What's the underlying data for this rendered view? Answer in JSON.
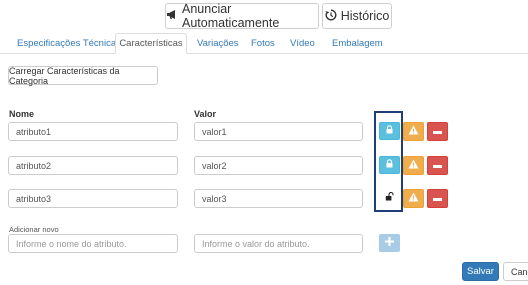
{
  "header": {
    "announce_label": "Anunciar Automaticamente",
    "history_label": "Histórico"
  },
  "tabs": [
    {
      "label": "Especificações Técnicas"
    },
    {
      "label": "Características"
    },
    {
      "label": "Variações"
    },
    {
      "label": "Fotos"
    },
    {
      "label": "Vídeo"
    },
    {
      "label": "Embalagem"
    }
  ],
  "load_button_label": "Carregar Características da Categoria",
  "columns": {
    "name": "Nome",
    "value": "Valor"
  },
  "rows": [
    {
      "name": "atributo1",
      "value": "valor1",
      "lock": "locked"
    },
    {
      "name": "atributo2",
      "value": "valor2",
      "lock": "locked"
    },
    {
      "name": "atributo3",
      "value": "valor3",
      "lock": "unlocked"
    }
  ],
  "add_new": {
    "label": "Adicionar novo",
    "name_placeholder": "Informe o nome do atributo.",
    "value_placeholder": "Informe o valor do atributo."
  },
  "footer": {
    "save_label": "Salvar",
    "cancel_label": "Canc"
  },
  "colors": {
    "primary": "#337ab7",
    "info": "#5bc0de",
    "warning": "#f0ad4e",
    "danger": "#d9534f",
    "highlight_border": "#1f3f7a"
  }
}
